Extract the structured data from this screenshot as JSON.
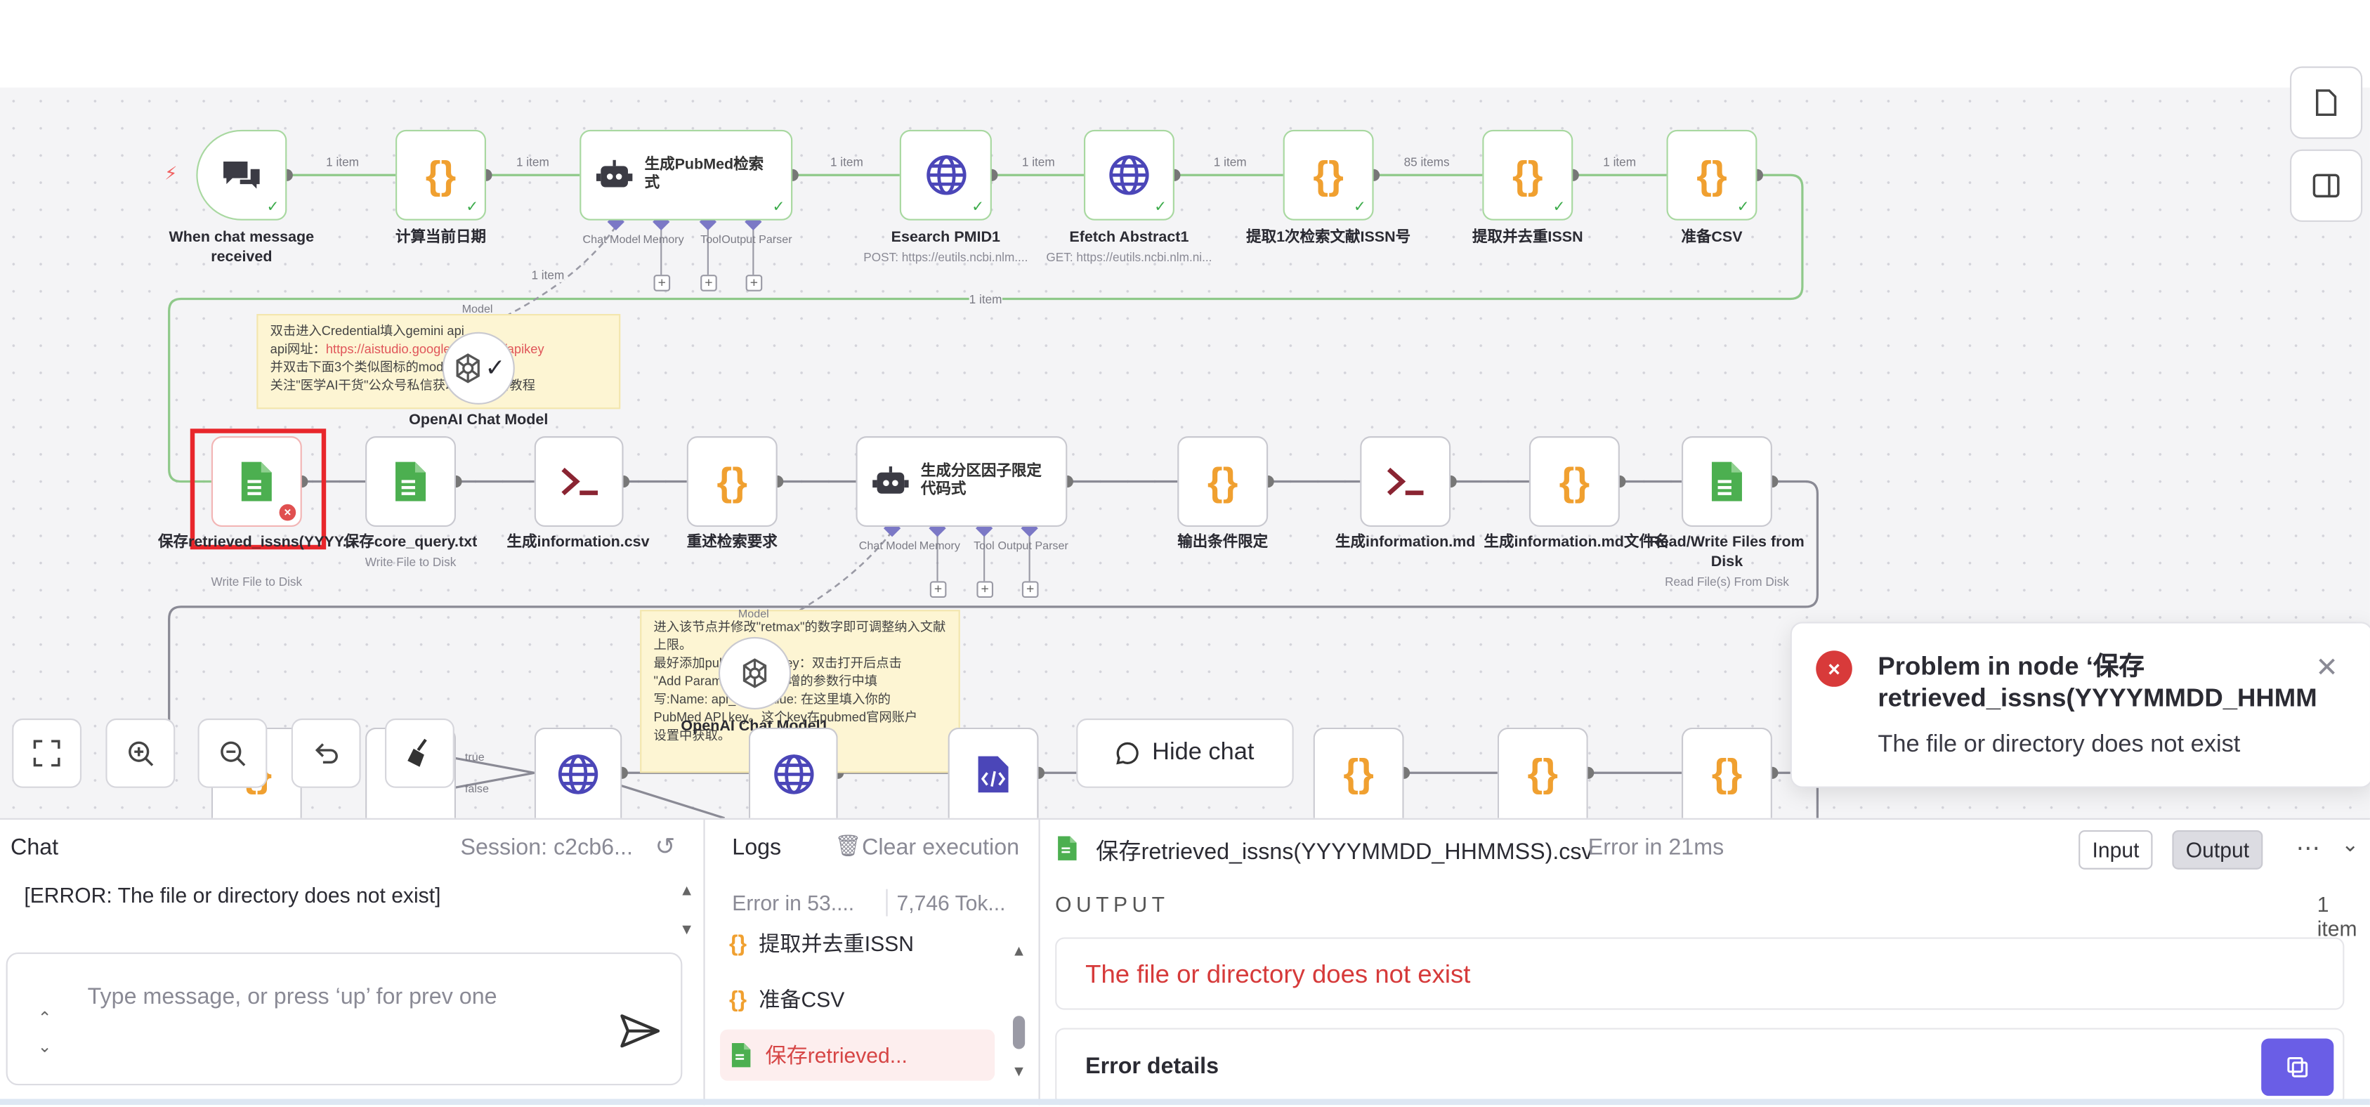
{
  "canvas": {
    "row1_edges": [
      "1 item",
      "1 item",
      "1 item",
      "1 item",
      "1 item",
      "85 items",
      "1 item"
    ],
    "loop_edge_label": "1 item",
    "model_edge_label": "1 item",
    "port_model": "Model",
    "port_model2": "Model",
    "port_true": "true",
    "port_false": "false"
  },
  "nodes": {
    "trigger": {
      "label": "When chat message received"
    },
    "date": {
      "label": "计算当前日期"
    },
    "agent1": {
      "title": "生成PubMed检索式",
      "ports": [
        "Chat Model",
        "Memory",
        "Tool",
        "Output Parser"
      ]
    },
    "esearch": {
      "label": "Esearch PMID1",
      "sub": "POST: https://eutils.ncbi.nlm...."
    },
    "efetch": {
      "label": "Efetch Abstract1",
      "sub": "GET: https://eutils.ncbi.nlm.ni..."
    },
    "extract": {
      "label": "提取1次检索文献ISSN号"
    },
    "dedup": {
      "label": "提取并去重ISSN"
    },
    "prepcsv": {
      "label": "准备CSV"
    },
    "openai1": {
      "label": "OpenAI Chat Model"
    },
    "save1": {
      "label": "保存retrieved_issns(YYYY...",
      "sub": "Write File to Disk"
    },
    "save2": {
      "label": "保存core_query.txt",
      "sub": "Write File to Disk"
    },
    "infocsv": {
      "label": "生成information.csv"
    },
    "restate": {
      "label": "重述检索要求"
    },
    "agent2": {
      "title": "生成分区因子限定代码式",
      "ports": [
        "Chat Model",
        "Memory",
        "Tool",
        "Output Parser"
      ]
    },
    "output_cond": {
      "label": "输出条件限定"
    },
    "infomd": {
      "label": "生成information.md"
    },
    "infomd_name": {
      "label": "生成information.md文件名"
    },
    "rwfiles": {
      "label": "Read/Write Files from Disk",
      "sub": "Read File(s) From Disk"
    },
    "openai2": {
      "label": "OpenAI Chat Model1"
    }
  },
  "sticky1": {
    "line1": "双击进入Credential填入gemini api",
    "line2a": "api网址：",
    "line2_link": "https://aistudio.google.com/app/apikey",
    "line3": "并双击下面3个类似图标的model",
    "line4": "关注\"医学AI干货\"公众号私信获取更多查看教程"
  },
  "sticky2": {
    "l1": "进入该节点并修改\"retmax\"的数字即可调整纳入文献上限。",
    "l2": "最好添加pubmed api_key：双击打开后点击",
    "l3": "\"Add Parameter\"，在新增的参数行中填",
    "l4": "写:Name: api_key, Value: 在这里填入你的",
    "l5": "PubMed API key。这个key在pubmed官网账户",
    "l6": "设置中获取。"
  },
  "controls": {
    "hide_chat": "Hide chat"
  },
  "toast": {
    "title_line1": "Problem in node ‘保存",
    "title_line2": "retrieved_issns(YYYYMMDD_HHMM",
    "message": "The file or directory does not exist"
  },
  "chat": {
    "title": "Chat",
    "session": "Session: c2cb6...",
    "message": "[ERROR: The file or directory does not exist]",
    "placeholder": "Type message, or press ‘up’ for prev one"
  },
  "logs": {
    "title": "Logs",
    "clear": "Clear execution",
    "status": "Error in 53....",
    "tokens": "7,746 Tok...",
    "items": [
      {
        "label": "提取并去重ISSN"
      },
      {
        "label": "准备CSV"
      },
      {
        "label": "保存retrieved..."
      }
    ]
  },
  "output": {
    "node_name": "保存retrieved_issns(YYYYMMDD_HHMMSS).csv",
    "status": "Error in 21ms",
    "tab_input": "Input",
    "tab_output": "Output",
    "section": "OUTPUT",
    "count": "1 item",
    "error": "The file or directory does not exist",
    "details_title": "Error details"
  },
  "colors": {
    "success": "#3bab4a",
    "error": "#d83a3a",
    "accent": "#6a5ee6",
    "code_orange": "#f0a030",
    "web_purple": "#4b46b8"
  }
}
